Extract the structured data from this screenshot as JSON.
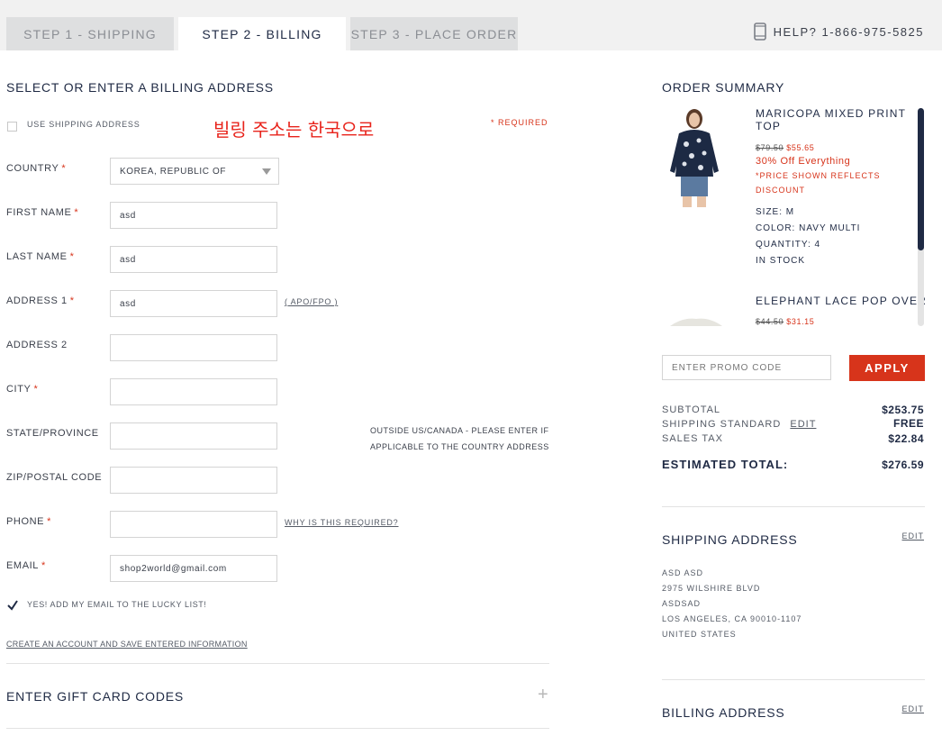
{
  "header": {
    "steps": [
      {
        "label": "STEP 1 - SHIPPING"
      },
      {
        "label": "STEP 2 - BILLING"
      },
      {
        "label": "STEP 3 - PLACE ORDER"
      }
    ],
    "help_text": "HELP? 1-866-975-5825"
  },
  "billing": {
    "title": "SELECT OR ENTER A BILLING ADDRESS",
    "use_shipping_label": "USE SHIPPING ADDRESS",
    "annotation": "빌링 주소는 한국으로",
    "required_note": "* REQUIRED",
    "country": {
      "label": "COUNTRY",
      "value": "KOREA, REPUBLIC OF"
    },
    "first_name": {
      "label": "FIRST NAME",
      "value": "asd"
    },
    "last_name": {
      "label": "LAST NAME",
      "value": "asd"
    },
    "address1": {
      "label": "ADDRESS 1",
      "value": "asd",
      "link": "( APO/FPO )"
    },
    "address2": {
      "label": "ADDRESS 2",
      "value": ""
    },
    "city": {
      "label": "CITY",
      "value": ""
    },
    "state": {
      "label": "STATE/PROVINCE",
      "value": "",
      "hint_line1": "OUTSIDE US/CANADA - PLEASE ENTER IF",
      "hint_line2": "APPLICABLE TO THE COUNTRY ADDRESS"
    },
    "zip": {
      "label": "ZIP/POSTAL CODE",
      "value": ""
    },
    "phone": {
      "label": "PHONE",
      "value": "",
      "link": "WHY IS THIS REQUIRED?"
    },
    "email": {
      "label": "EMAIL",
      "value": "shop2world@gmail.com"
    },
    "lucky_list_label": "YES! ADD MY EMAIL TO THE LUCKY LIST!",
    "create_account_link": "CREATE AN ACCOUNT AND SAVE ENTERED INFORMATION",
    "required_mark": "*"
  },
  "gift_card": {
    "title": "ENTER GIFT CARD CODES",
    "expand": "+"
  },
  "summary": {
    "title": "ORDER SUMMARY",
    "items": [
      {
        "name_line1": "MARICOPA MIXED PRINT",
        "name_line2": "TOP",
        "old_price": "$79.50",
        "new_price": "$55.65",
        "promo": "30% Off Everything",
        "note_line1": "*PRICE SHOWN REFLECTS",
        "note_line2": "DISCOUNT",
        "size": "SIZE: M",
        "color": "COLOR: NAVY MULTI",
        "quantity": "QUANTITY: 4",
        "stock": "IN STOCK"
      },
      {
        "name_line1": "ELEPHANT LACE POP OVER",
        "old_price": "$44.50",
        "new_price": "$31.15"
      }
    ],
    "promo_placeholder": "ENTER PROMO CODE",
    "apply_label": "APPLY",
    "subtotal_label": "SUBTOTAL",
    "subtotal_value": "$253.75",
    "shipping_label": "SHIPPING STANDARD",
    "shipping_edit": "EDIT",
    "shipping_value": "FREE",
    "tax_label": "SALES TAX",
    "tax_value": "$22.84",
    "total_label": "ESTIMATED TOTAL:",
    "total_value": "$276.59"
  },
  "shipping_address": {
    "title": "SHIPPING ADDRESS",
    "edit": "EDIT",
    "lines": [
      "ASD ASD",
      "2975 WILSHIRE BLVD",
      "ASDSAD",
      "LOS ANGELES, CA 90010-1107",
      "UNITED STATES"
    ]
  },
  "billing_address": {
    "title": "BILLING ADDRESS",
    "edit": "EDIT"
  }
}
